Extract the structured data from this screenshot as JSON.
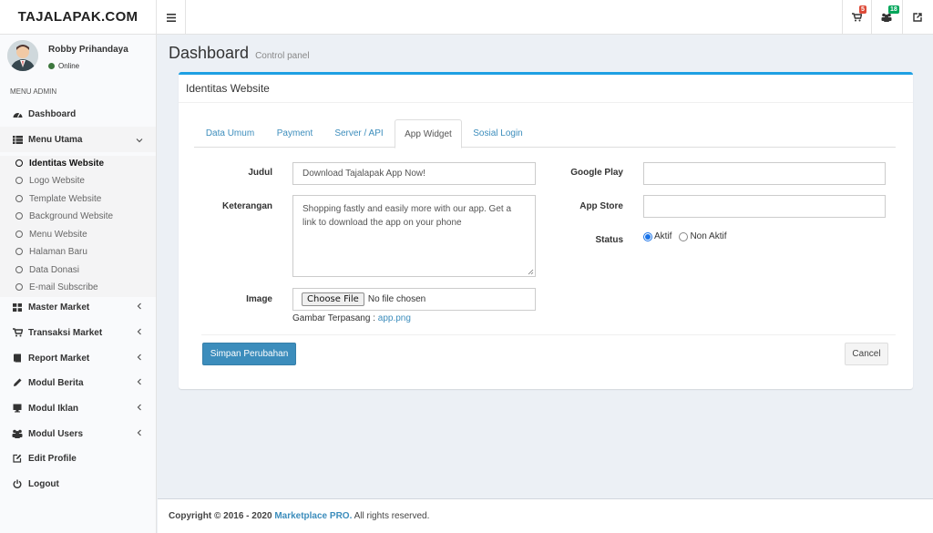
{
  "header": {
    "logo": "TAJALAPAK.COM",
    "cart_badge": "5",
    "users_badge": "18",
    "icons": [
      "bars-icon",
      "cart-icon",
      "users-icon",
      "external-link-icon"
    ],
    "colors": {
      "cart_badge": "#dd4b39",
      "users_badge": "#00a65a"
    }
  },
  "sidebar": {
    "user_name": "Robby Prihandaya",
    "user_status": "Online",
    "menu_header": "MENU ADMIN",
    "items": [
      {
        "label": "Dashboard",
        "icon": "dashboard-icon"
      },
      {
        "label": "Menu Utama",
        "icon": "list-icon"
      },
      {
        "label": "Master Market",
        "icon": "grid-icon"
      },
      {
        "label": "Transaksi Market",
        "icon": "cart-icon"
      },
      {
        "label": "Report Market",
        "icon": "book-icon"
      },
      {
        "label": "Modul Berita",
        "icon": "pencil-icon"
      },
      {
        "label": "Modul Iklan",
        "icon": "desktop-icon"
      },
      {
        "label": "Modul Users",
        "icon": "users-icon"
      },
      {
        "label": "Edit Profile",
        "icon": "edit-icon"
      },
      {
        "label": "Logout",
        "icon": "power-icon"
      }
    ],
    "submenu": [
      "Identitas Website",
      "Logo Website",
      "Template Website",
      "Background Website",
      "Menu Website",
      "Halaman Baru",
      "Data Donasi",
      "E-mail Subscribe"
    ]
  },
  "content": {
    "title": "Dashboard",
    "subtitle": "Control panel",
    "box_title": "Identitas Website",
    "tabs": [
      "Data Umum",
      "Payment",
      "Server / API",
      "App Widget",
      "Sosial Login"
    ],
    "active_tab": "App Widget",
    "form": {
      "judul_label": "Judul",
      "judul_value": "Download Tajalapak App Now!",
      "keterangan_label": "Keterangan",
      "keterangan_value": "Shopping fastly and easily more with our app. Get a link to download the app on your phone",
      "image_label": "Image",
      "file_button": "Choose File",
      "file_status": "No file chosen",
      "gambar_prefix": "Gambar Terpasang : ",
      "gambar_file": "app.png",
      "google_play_label": "Google Play",
      "google_play_value": "",
      "app_store_label": "App Store",
      "app_store_value": "",
      "status_label": "Status",
      "status_options": [
        "Aktif",
        "Non Aktif"
      ],
      "status_selected": "Aktif"
    },
    "save_button": "Simpan Perubahan",
    "cancel_button": "Cancel",
    "accent_color": "#3c8dbc"
  },
  "footer": {
    "prefix": "Copyright © 2016 - 2020",
    "brand": "Marketplace PRO.",
    "suffix": "All rights reserved."
  }
}
